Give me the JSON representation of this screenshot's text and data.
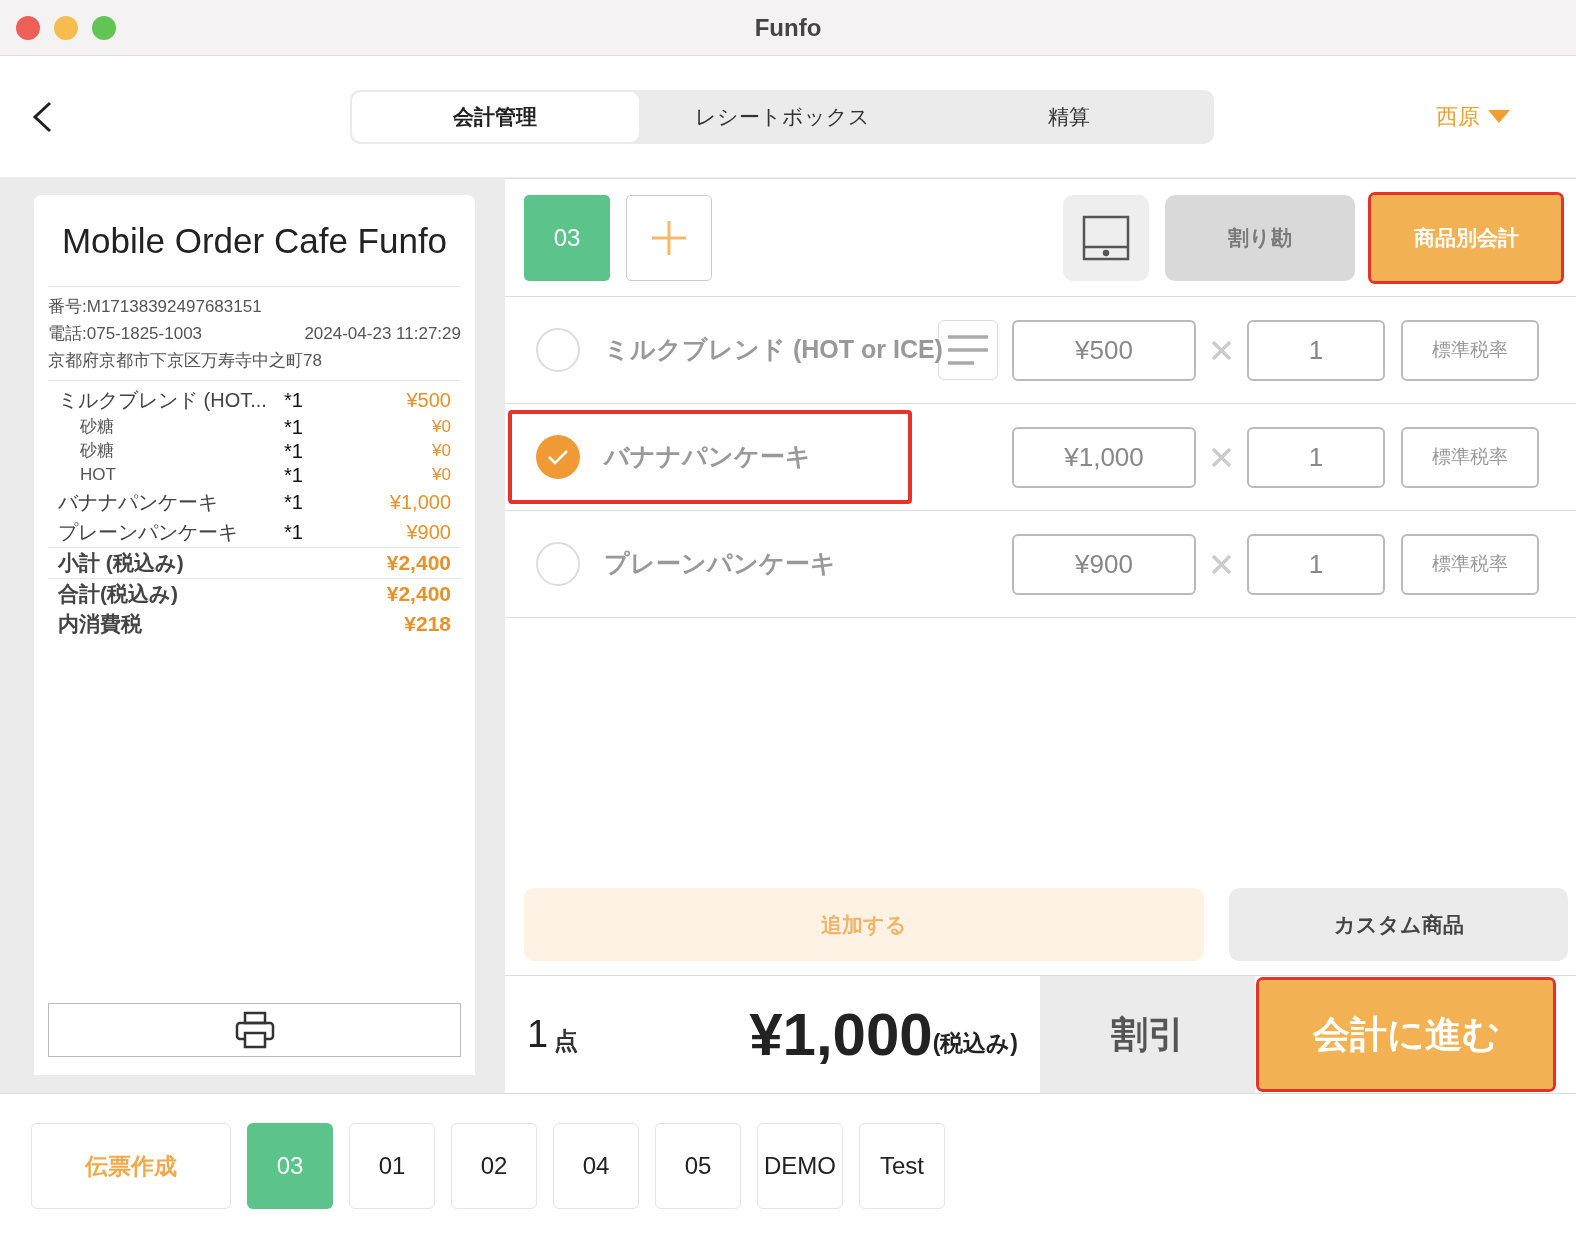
{
  "window": {
    "title": "Funfo"
  },
  "header": {
    "tabs": [
      {
        "label": "会計管理",
        "selected": true
      },
      {
        "label": "レシートボックス",
        "selected": false
      },
      {
        "label": "精算",
        "selected": false
      }
    ],
    "user": "西原"
  },
  "receipt": {
    "store_name": "Mobile Order Cafe Funfo",
    "number": "番号:M17138392497683151",
    "phone": "電話:075-1825-1003",
    "datetime": "2024-04-23 11:27:29",
    "address": "京都府京都市下京区万寿寺中之町78",
    "items": [
      {
        "name": "ミルクブレンド (HOT...",
        "qty": "*1",
        "price": "¥500",
        "children": [
          {
            "name": "砂糖",
            "qty": "*1",
            "price": "¥0"
          },
          {
            "name": "砂糖",
            "qty": "*1",
            "price": "¥0"
          },
          {
            "name": "HOT",
            "qty": "*1",
            "price": "¥0"
          }
        ]
      },
      {
        "name": "バナナパンケーキ",
        "qty": "*1",
        "price": "¥1,000"
      },
      {
        "name": "プレーンパンケーキ",
        "qty": "*1",
        "price": "¥900"
      }
    ],
    "summary": [
      {
        "label": "小計 (税込み)",
        "value": "¥2,400"
      },
      {
        "label": "合計(税込み)",
        "value": "¥2,400"
      },
      {
        "label": "内消費税",
        "value": "¥218"
      }
    ]
  },
  "toolbar": {
    "table": "03",
    "split": {
      "label": "割り勘",
      "disabled": true
    },
    "item_checkout": {
      "label": "商品別会計",
      "highlighted": true
    }
  },
  "order_lines": [
    {
      "name": "ミルクブレンド (HOT or ICE)",
      "selected": false,
      "highlighted": false,
      "has_options": true,
      "price": "¥500",
      "qty": "1",
      "tax": "標準税率"
    },
    {
      "name": "バナナパンケーキ",
      "selected": true,
      "highlighted": true,
      "has_options": false,
      "price": "¥1,000",
      "qty": "1",
      "tax": "標準税率"
    },
    {
      "name": "プレーンパンケーキ",
      "selected": false,
      "highlighted": false,
      "has_options": false,
      "price": "¥900",
      "qty": "1",
      "tax": "標準税率"
    }
  ],
  "actions": {
    "add": "追加する",
    "custom": "カスタム商品"
  },
  "footer": {
    "count": "1",
    "unit": "点",
    "total": "¥1,000",
    "tax_note": "(税込み)",
    "discount": "割引",
    "checkout": {
      "label": "会計に進む",
      "highlighted": true
    }
  },
  "bottom": {
    "create": "伝票作成",
    "tickets": [
      {
        "label": "03",
        "selected": true
      },
      {
        "label": "01",
        "selected": false
      },
      {
        "label": "02",
        "selected": false
      },
      {
        "label": "04",
        "selected": false
      },
      {
        "label": "05",
        "selected": false
      },
      {
        "label": "DEMO",
        "selected": false
      },
      {
        "label": "Test",
        "selected": false
      }
    ]
  }
}
